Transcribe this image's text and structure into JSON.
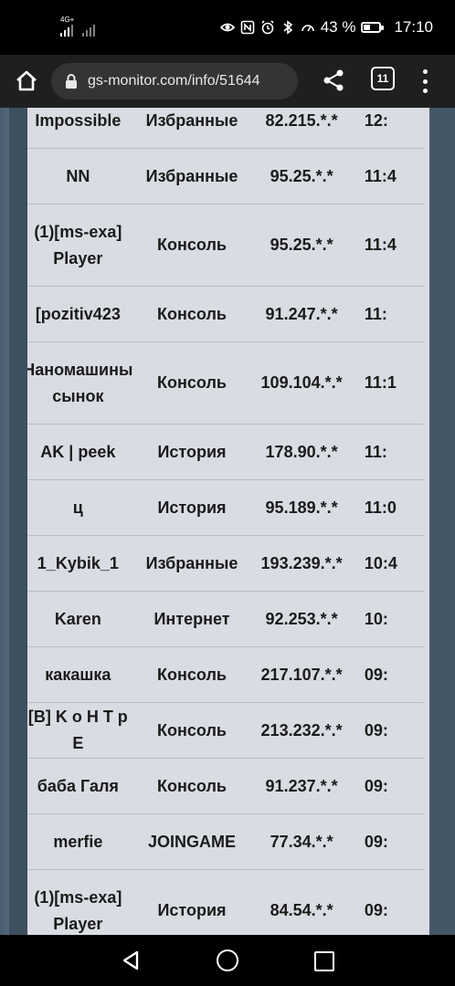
{
  "status_bar": {
    "network_label": "4G+",
    "battery_percent": "43 %",
    "battery_level": 0.43,
    "time": "17:10",
    "icons": [
      "eye-icon",
      "nfc-icon",
      "alarm-icon",
      "bluetooth-icon",
      "speedometer-icon"
    ]
  },
  "browser": {
    "url": "gs-monitor.com/info/51644",
    "tab_count": "11",
    "icons": [
      "home-icon",
      "lock-icon",
      "share-icon",
      "tabs-icon",
      "more-menu-icon"
    ]
  },
  "table": {
    "rows": [
      {
        "name": "Impossible",
        "source": "Избранные",
        "ip": "82.215.*.*",
        "time": "12:"
      },
      {
        "name": "NN",
        "source": "Избранные",
        "ip": "95.25.*.*",
        "time": "11:4"
      },
      {
        "name": "(1)[ms-exa] Player",
        "source": "Консоль",
        "ip": "95.25.*.*",
        "time": "11:4"
      },
      {
        "name": "[pozitiv423",
        "source": "Консоль",
        "ip": "91.247.*.*",
        "time": "11:"
      },
      {
        "name": "Наномашины сынок",
        "source": "Консоль",
        "ip": "109.104.*.*",
        "time": "11:1"
      },
      {
        "name": "AK | peek",
        "source": "История",
        "ip": "178.90.*.*",
        "time": "11:"
      },
      {
        "name": "ц",
        "source": "История",
        "ip": "95.189.*.*",
        "time": "11:0"
      },
      {
        "name": "1_Kybik_1",
        "source": "Избранные",
        "ip": "193.239.*.*",
        "time": "10:4"
      },
      {
        "name": "Karen",
        "source": "Интернет",
        "ip": "92.253.*.*",
        "time": "10:"
      },
      {
        "name": "какашка",
        "source": "Консоль",
        "ip": "217.107.*.*",
        "time": "09:"
      },
      {
        "name": "[B] K o H T p E",
        "source": "Консоль",
        "ip": "213.232.*.*",
        "time": "09:"
      },
      {
        "name": "баба Галя",
        "source": "Консоль",
        "ip": "91.237.*.*",
        "time": "09:"
      },
      {
        "name": "merfie",
        "source": "JOINGAME",
        "ip": "77.34.*.*",
        "time": "09:"
      },
      {
        "name": "(1)[ms-exa] Player",
        "source": "История",
        "ip": "84.54.*.*",
        "time": "09:"
      }
    ]
  },
  "nav_bar": {
    "icons": [
      "back-icon",
      "home-circle-icon",
      "recents-icon"
    ]
  }
}
